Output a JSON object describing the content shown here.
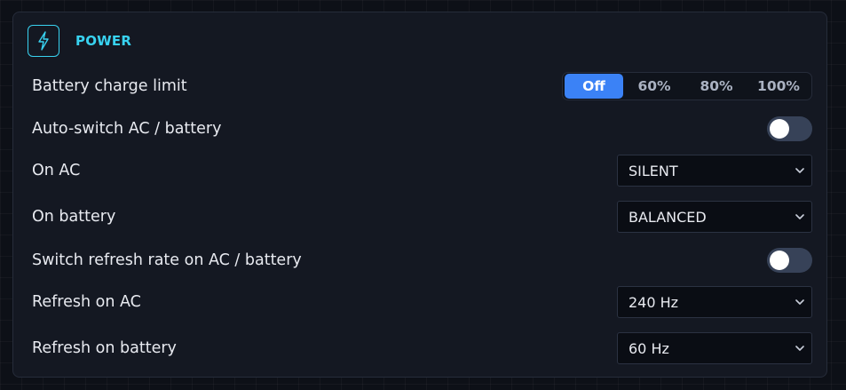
{
  "section": {
    "title": "POWER",
    "icon": "lightning-bolt-icon",
    "accent_color": "#38d2f0"
  },
  "battery_charge_limit": {
    "label": "Battery charge limit",
    "options": [
      "Off",
      "60%",
      "80%",
      "100%"
    ],
    "selected": "Off",
    "active_color": "#3b82f6"
  },
  "auto_switch": {
    "label": "Auto-switch AC / battery",
    "enabled": false
  },
  "on_ac": {
    "label": "On AC",
    "value": "SILENT"
  },
  "on_battery": {
    "label": "On battery",
    "value": "BALANCED"
  },
  "switch_refresh": {
    "label": "Switch refresh rate on AC / battery",
    "enabled": false
  },
  "refresh_ac": {
    "label": "Refresh on AC",
    "value": "240 Hz"
  },
  "refresh_battery": {
    "label": "Refresh on battery",
    "value": "60 Hz"
  }
}
